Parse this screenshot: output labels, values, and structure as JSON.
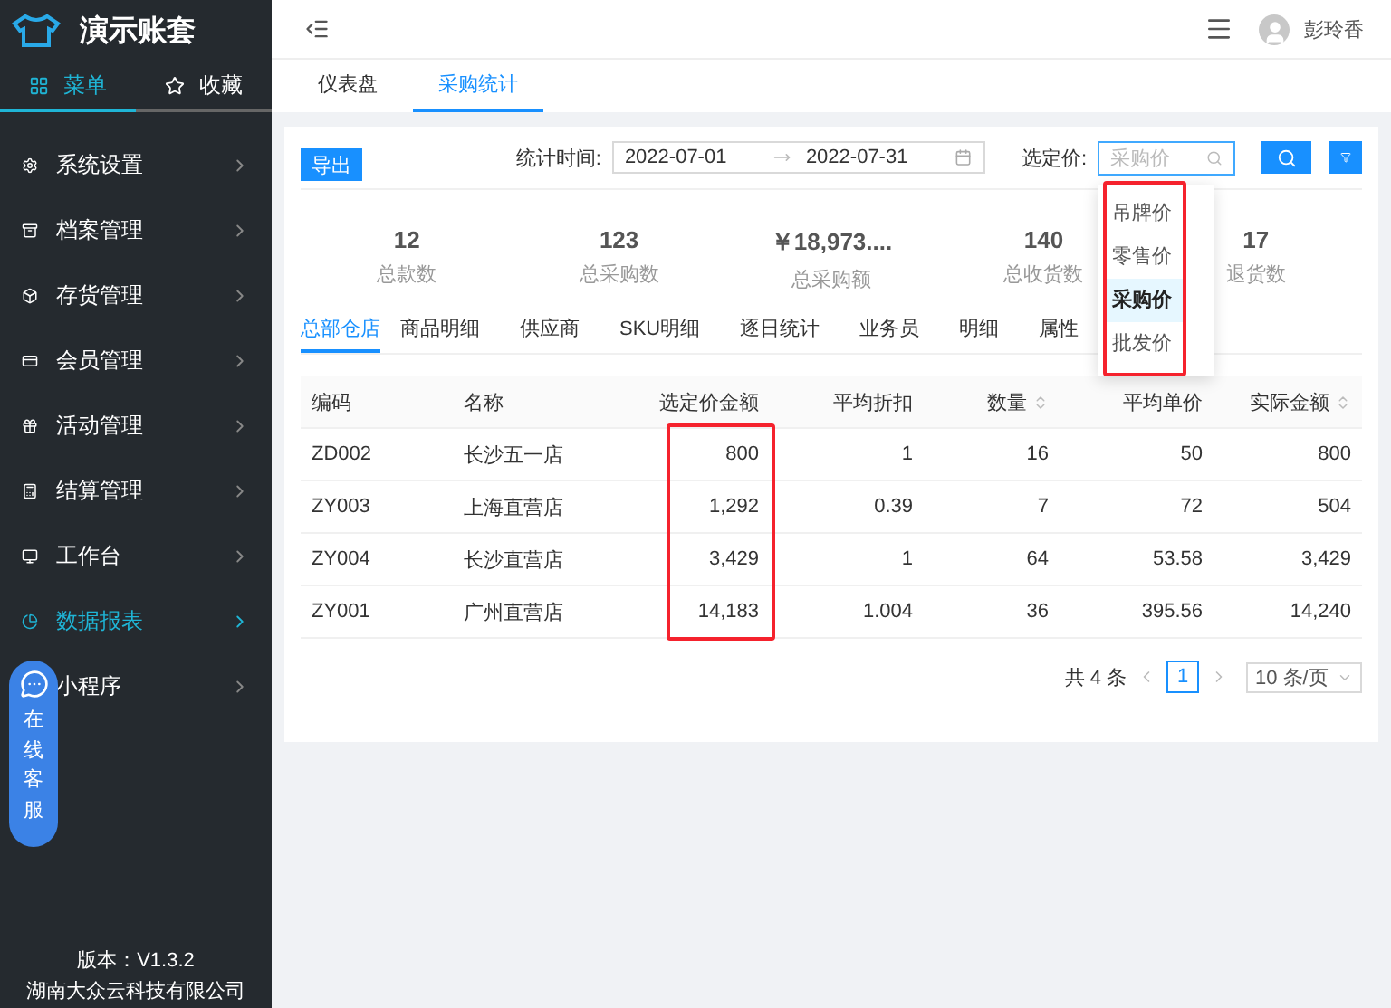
{
  "brand": {
    "title": "演示账套"
  },
  "sidebar_tabs": [
    {
      "label": "菜单",
      "selected": true
    },
    {
      "label": "收藏",
      "selected": false
    }
  ],
  "sidebar": {
    "items": [
      {
        "label": "系统设置",
        "selected": false
      },
      {
        "label": "档案管理",
        "selected": false
      },
      {
        "label": "存货管理",
        "selected": false
      },
      {
        "label": "会员管理",
        "selected": false
      },
      {
        "label": "活动管理",
        "selected": false
      },
      {
        "label": "结算管理",
        "selected": false
      },
      {
        "label": "工作台",
        "selected": false
      },
      {
        "label": "数据报表",
        "selected": true
      },
      {
        "label": "小程序",
        "selected": false
      }
    ]
  },
  "chat_widget": {
    "label": "在线客服"
  },
  "footer": {
    "version": "版本：V1.3.2",
    "company": "湖南大众云科技有限公司"
  },
  "header": {
    "user": "彭玲香"
  },
  "page_tabs": [
    {
      "label": "仪表盘",
      "selected": false
    },
    {
      "label": "采购统计",
      "selected": true
    }
  ],
  "toolbar": {
    "export": "导出",
    "date_label": "统计时间:",
    "start": "2022-07-01",
    "end": "2022-07-31",
    "price_label": "选定价:",
    "price_placeholder": "采购价"
  },
  "price_options": [
    {
      "label": "吊牌价",
      "selected": false
    },
    {
      "label": "零售价",
      "selected": false
    },
    {
      "label": "采购价",
      "selected": true
    },
    {
      "label": "批发价",
      "selected": false
    }
  ],
  "stats": [
    {
      "value": "12",
      "label": "总款数"
    },
    {
      "value": "123",
      "label": "总采购数"
    },
    {
      "value": "￥18,973....",
      "label": "总采购额"
    },
    {
      "value": "140",
      "label": "总收货数"
    },
    {
      "value": "17",
      "label": "退货数"
    }
  ],
  "sub_tabs": [
    {
      "label": "总部仓店",
      "selected": true
    },
    {
      "label": "商品明细",
      "selected": false
    },
    {
      "label": "供应商",
      "selected": false
    },
    {
      "label": "SKU明细",
      "selected": false
    },
    {
      "label": "逐日统计",
      "selected": false
    },
    {
      "label": "业务员",
      "selected": false
    },
    {
      "label": "明细",
      "selected": false
    },
    {
      "label": "属性",
      "selected": false
    }
  ],
  "table": {
    "columns": [
      {
        "label": "编码",
        "sortable": false
      },
      {
        "label": "名称",
        "sortable": false
      },
      {
        "label": "选定价金额",
        "sortable": false
      },
      {
        "label": "平均折扣",
        "sortable": false
      },
      {
        "label": "数量",
        "sortable": true
      },
      {
        "label": "平均单价",
        "sortable": false
      },
      {
        "label": "实际金额",
        "sortable": true
      }
    ],
    "rows": [
      [
        "ZD002",
        "长沙五一店",
        "800",
        "1",
        "16",
        "50",
        "800"
      ],
      [
        "ZY003",
        "上海直营店",
        "1,292",
        "0.39",
        "7",
        "72",
        "504"
      ],
      [
        "ZY004",
        "长沙直营店",
        "3,429",
        "1",
        "64",
        "53.58",
        "3,429"
      ],
      [
        "ZY001",
        "广州直营店",
        "14,183",
        "1.004",
        "36",
        "395.56",
        "14,240"
      ]
    ]
  },
  "pagination": {
    "total": "共 4 条",
    "page": "1",
    "page_size": "10 条/页"
  }
}
